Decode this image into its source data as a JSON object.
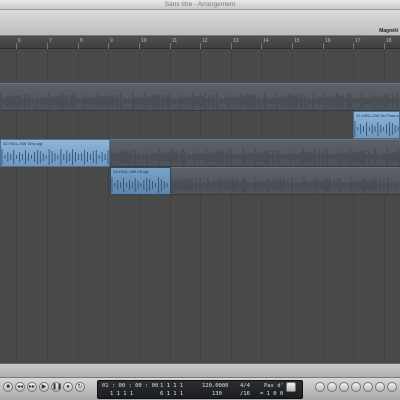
{
  "window": {
    "title": "Sans titre - Arrangement"
  },
  "toolbar": {
    "snap_label": "Magnéti"
  },
  "ruler": {
    "bars": [
      "6",
      "7",
      "8",
      "9",
      "10",
      "11",
      "12",
      "13",
      "14",
      "15",
      "16",
      "17",
      "18"
    ]
  },
  "regions": [
    {
      "name": "",
      "style": "dark"
    },
    {
      "name": "22-HIGL-030 Su Floor.ogl",
      "style": "blue"
    },
    {
      "name": "32-HIGL-035 Timo.ogl",
      "style": "blue"
    },
    {
      "name": "",
      "style": "dark"
    },
    {
      "name": "13-HIGL-089 Hil.ogl",
      "style": "blue-active"
    },
    {
      "name": "",
      "style": "dark"
    }
  ],
  "transport": {
    "buttons": [
      "stop",
      "rewind",
      "fast-forward",
      "play",
      "pause",
      "record",
      "cycle"
    ],
    "lcd": {
      "smpte": "01 : 00 : 00 : 00",
      "smpte_sub": "1    1    1    1",
      "bars": "1   1   1   1",
      "bars_sub": "6   1   1   1",
      "tempo": "120.0000",
      "tempo_sub": "130",
      "sig": "4/4",
      "sig_sub": "/16",
      "mode": "Pas d' in",
      "mode_sub": "= 1   0   0"
    }
  },
  "colors": {
    "region_blue": "#7aa3c8",
    "region_dark": "#555b61",
    "background": "#494949"
  }
}
